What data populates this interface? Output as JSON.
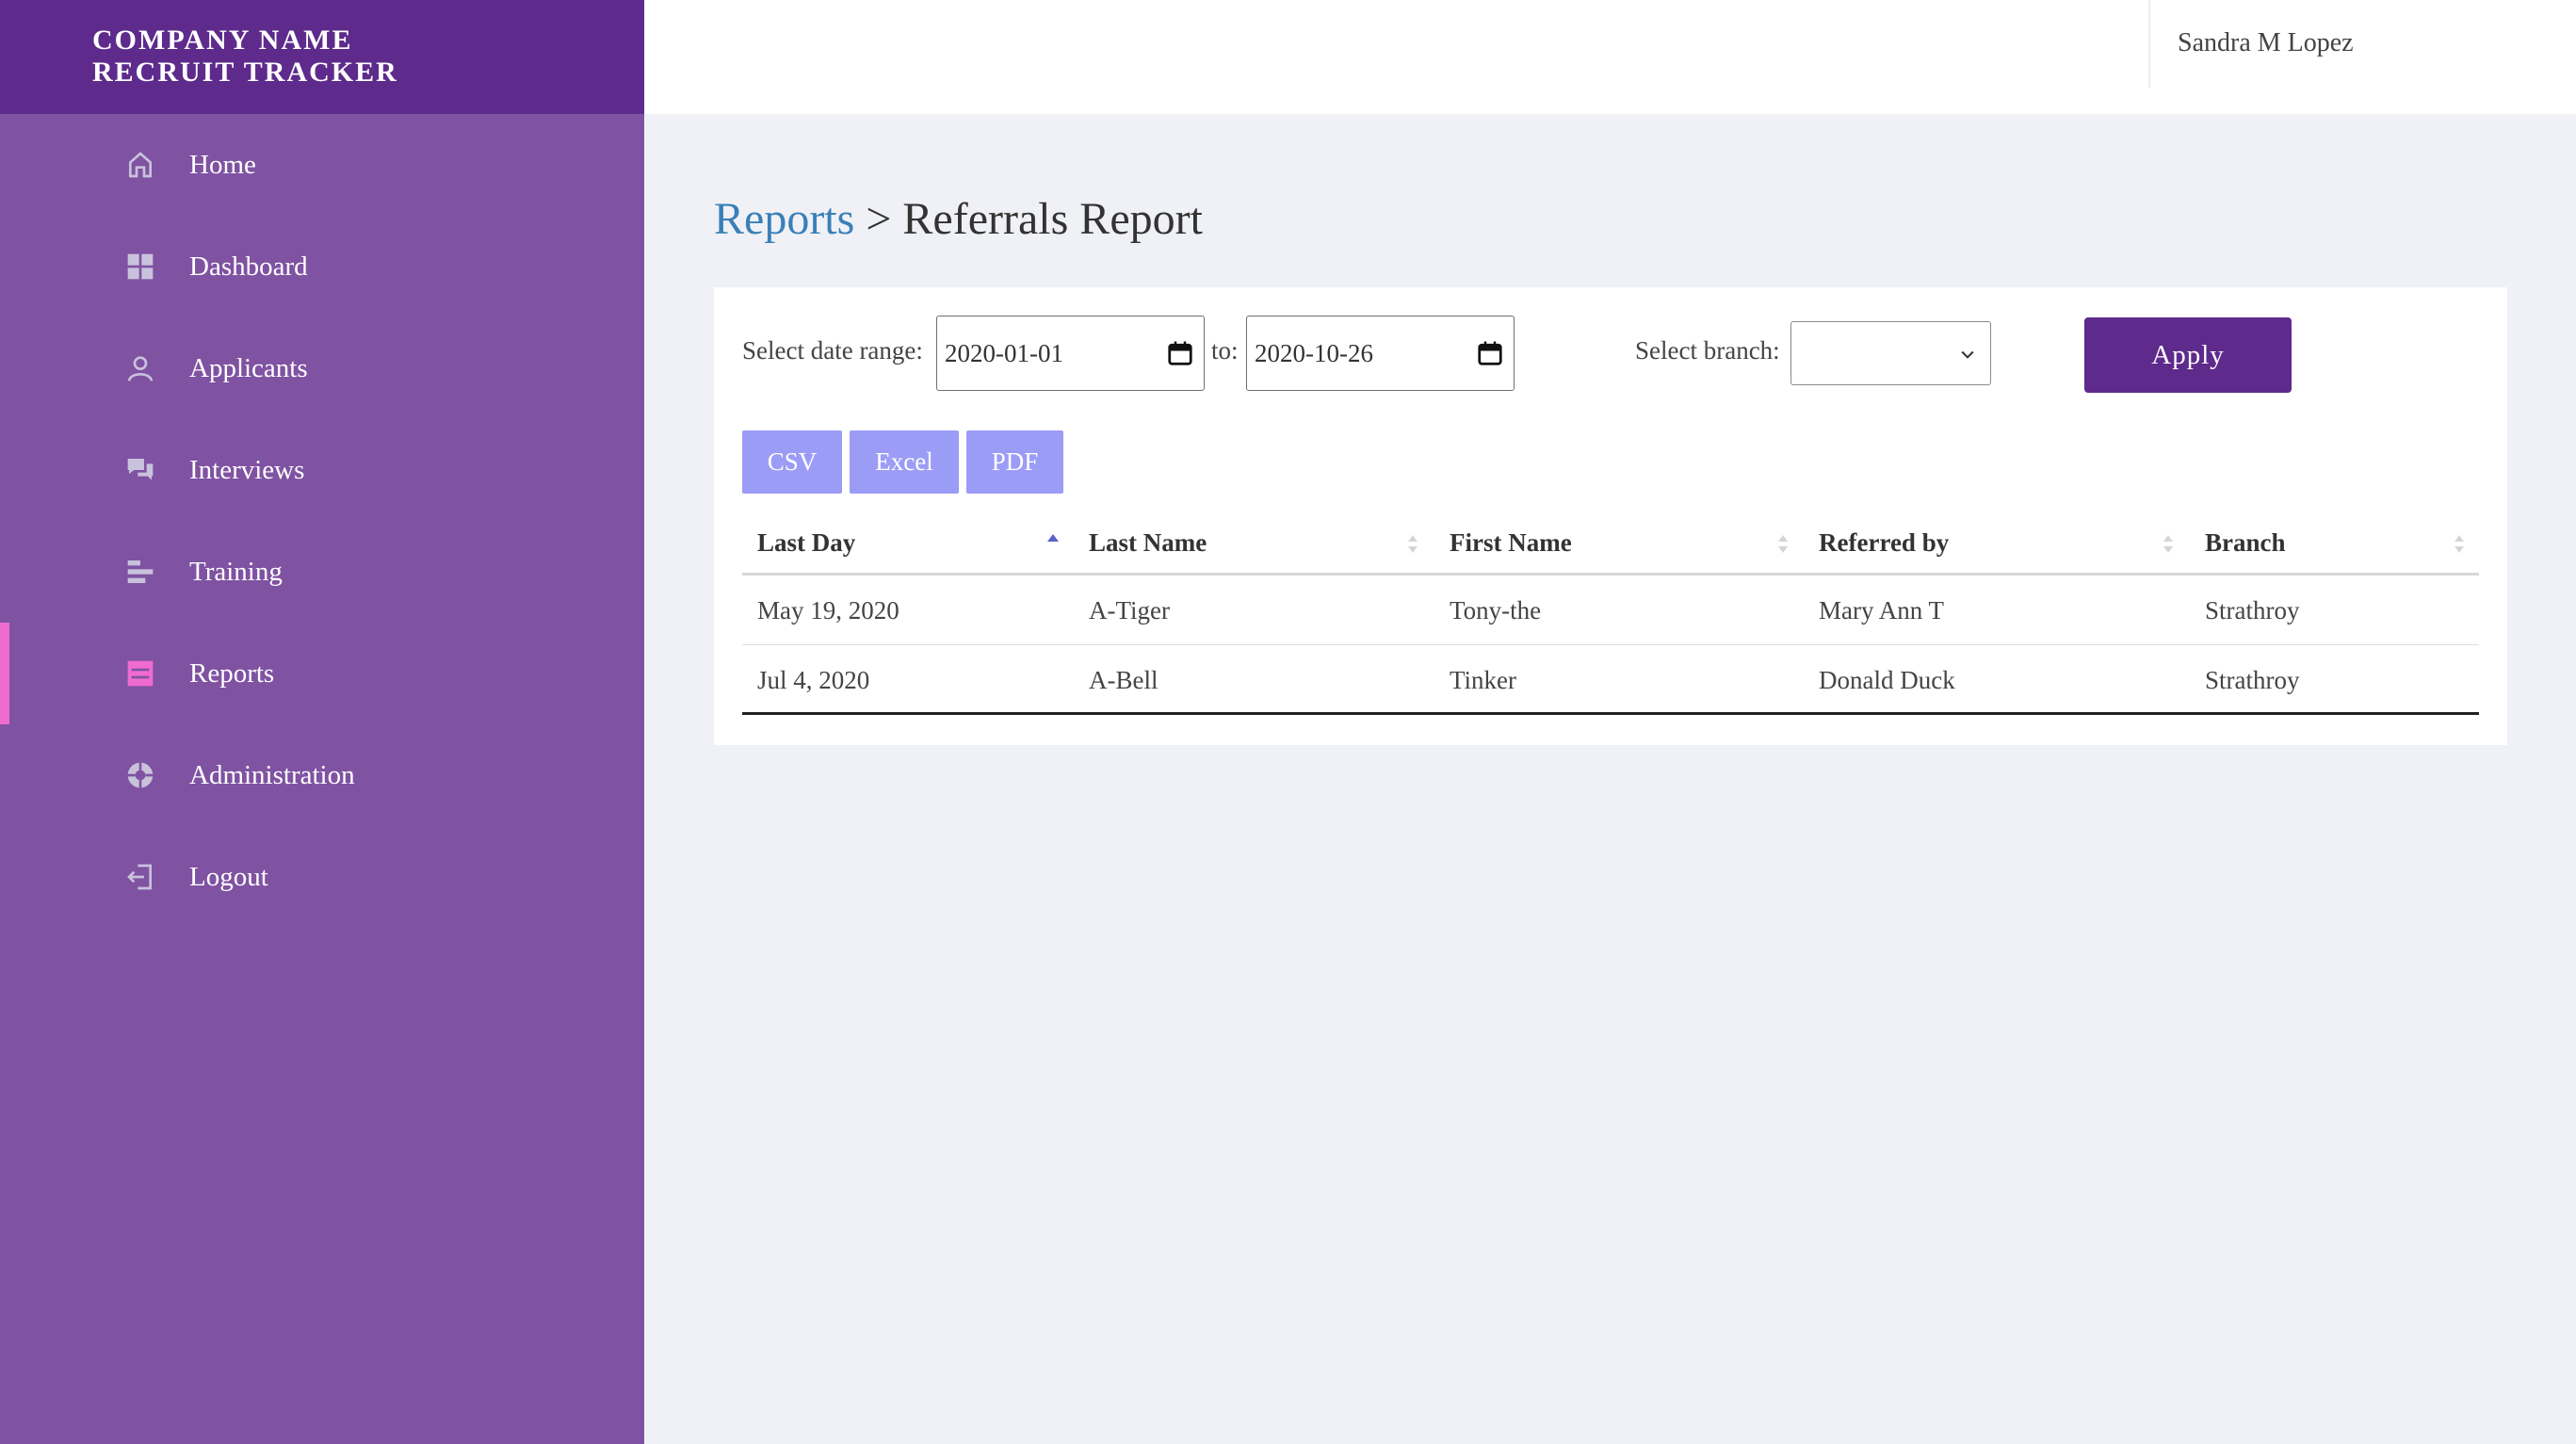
{
  "brand": {
    "line1": "COMPANY NAME",
    "line2": "RECRUIT TRACKER"
  },
  "sidebar": {
    "items": [
      {
        "label": "Home",
        "icon": "home-icon"
      },
      {
        "label": "Dashboard",
        "icon": "dashboard-icon"
      },
      {
        "label": "Applicants",
        "icon": "user-icon"
      },
      {
        "label": "Interviews",
        "icon": "chat-icon"
      },
      {
        "label": "Training",
        "icon": "training-icon"
      },
      {
        "label": "Reports",
        "icon": "reports-icon",
        "active": true
      },
      {
        "label": "Administration",
        "icon": "administration-icon"
      },
      {
        "label": "Logout",
        "icon": "logout-icon"
      }
    ]
  },
  "topbar": {
    "user": "Sandra M Lopez"
  },
  "breadcrumb": {
    "parent": "Reports",
    "separator": " > ",
    "current": "Referrals Report"
  },
  "filters": {
    "date_label": "Select date range:",
    "from": "2020-01-01",
    "to_label": "to:",
    "to": "2020-10-26",
    "branch_label": "Select branch:",
    "branch_value": "",
    "apply": "Apply"
  },
  "export": {
    "csv": "CSV",
    "excel": "Excel",
    "pdf": "PDF"
  },
  "table": {
    "columns": [
      "Last Day",
      "Last Name",
      "First Name",
      "Referred by",
      "Branch"
    ],
    "rows": [
      [
        "May 19, 2020",
        "A-Tiger",
        "Tony-the",
        "Mary Ann T",
        "Strathroy"
      ],
      [
        "Jul 4, 2020",
        "A-Bell",
        "Tinker",
        "Donald Duck",
        "Strathroy"
      ]
    ]
  },
  "colors": {
    "sidebar": "#7f52a2",
    "brand": "#5e2a8c",
    "accent": "#5e2a8c",
    "active_marker": "#f06bd0",
    "export_button": "#9b9cf6",
    "link": "#3a80b8"
  }
}
